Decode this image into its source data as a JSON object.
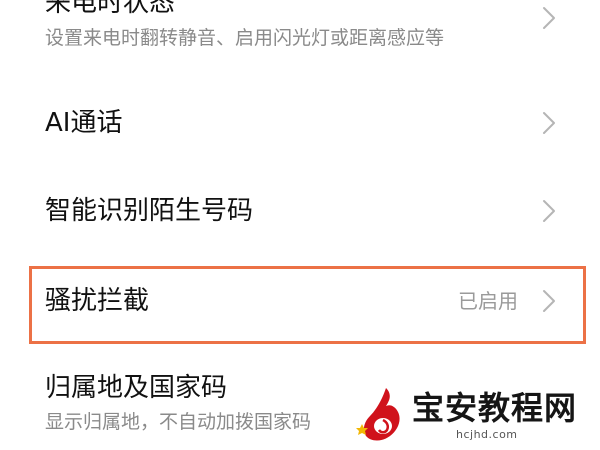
{
  "settings": {
    "items": [
      {
        "title": "来电时状态",
        "subtitle": "设置来电时翻转静音、启用闪光灯或距离感应等",
        "status": ""
      },
      {
        "title": "AI通话",
        "subtitle": "",
        "status": ""
      },
      {
        "title": "智能识别陌生号码",
        "subtitle": "",
        "status": ""
      },
      {
        "title": "骚扰拦截",
        "subtitle": "",
        "status": "已启用"
      },
      {
        "title": "归属地及国家码",
        "subtitle": "显示归属地，不自动加拨国家码",
        "status": ""
      }
    ]
  },
  "icons": {
    "chevron": "chevron-right-icon"
  },
  "colors": {
    "highlight_border": "#ec7146",
    "title_text": "#111111",
    "subtitle_text": "#8a8a8a",
    "chevron": "#b5b5b5"
  },
  "watermark": {
    "brand": "宝安教程网",
    "url": "hcjhd.com"
  }
}
